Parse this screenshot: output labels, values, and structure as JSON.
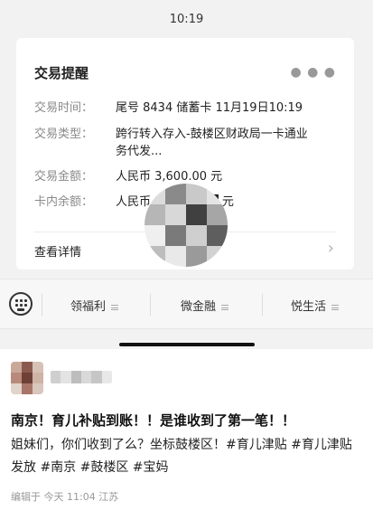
{
  "status_bar": {
    "time": "10:19"
  },
  "card": {
    "title": "交易提醒",
    "more_icon": "more-icon",
    "rows": [
      {
        "label": "交易时间：",
        "value": "尾号 8434 储蓄卡 11月19日10:19"
      },
      {
        "label": "交易类型：",
        "value": "跨行转入存入-鼓楼区财政局一卡通业务代发..."
      },
      {
        "label": "交易金额：",
        "value": "人民币 3,600.00 元"
      },
      {
        "label": "卡内余额：",
        "value": "人民币 3,6█████ 元"
      }
    ],
    "detail_label": "查看详情"
  },
  "menu": {
    "keyboard_icon": "keyboard-icon",
    "items": [
      {
        "label": "领福利"
      },
      {
        "label": "微金融"
      },
      {
        "label": "悦生活"
      }
    ]
  },
  "post": {
    "title": "南京！育儿补贴到账！！是谁收到了第一笔！！",
    "body": "姐妹们，你们收到了么？坐标鼓楼区！#育儿津贴 #育儿津贴发放 #南京 #鼓楼区 #宝妈",
    "meta": "编辑于 今天 11:04 江苏"
  },
  "colors": {
    "chat_bg": "#f2f2f2",
    "card_bg": "#ffffff",
    "label_gray": "#8a8a8a",
    "accent_text": "#111111"
  }
}
